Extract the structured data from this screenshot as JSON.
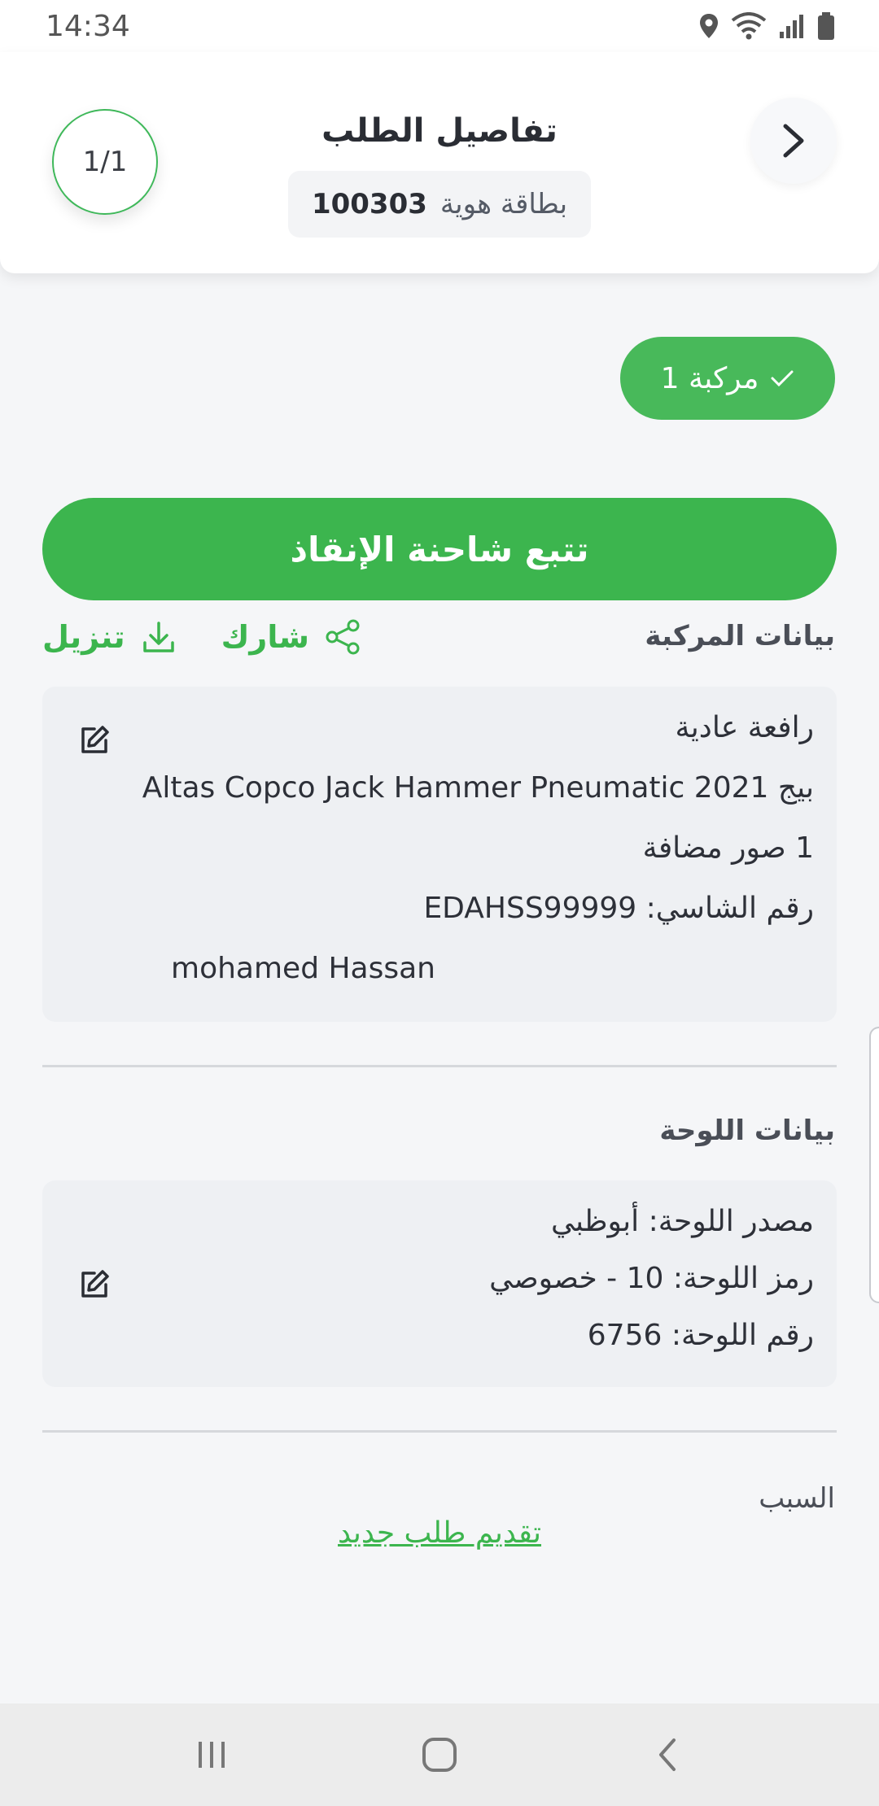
{
  "status_bar": {
    "time": "14:34",
    "icons": [
      "location-icon",
      "wifi-icon",
      "signal-icon",
      "battery-icon"
    ]
  },
  "header": {
    "title": "تفاصيل الطلب",
    "counter": "1/1",
    "id_label": "بطاقة هوية",
    "id_number": "100303"
  },
  "vehicle_chip": {
    "label": "مركبة 1"
  },
  "track_button": {
    "label": "تتبع شاحنة الإنقاذ"
  },
  "vehicle_section": {
    "title": "بيانات المركبة",
    "share_label": "شارك",
    "download_label": "تنزيل",
    "lines": [
      "رافعة عادية",
      "بيج 2021 Altas Copco Jack Hammer Pneumatic",
      "1 صور مضافة",
      "رقم الشاسي: EDAHSS99999",
      "mohamed Hassan"
    ]
  },
  "plate_section": {
    "title": "بيانات اللوحة",
    "lines": [
      "مصدر اللوحة: أبوظبي",
      "رمز اللوحة: 10 - خصوصي",
      "رقم اللوحة: 6756"
    ]
  },
  "reason": {
    "title": "السبب"
  },
  "new_request": {
    "label": "تقديم طلب جديد"
  },
  "colors": {
    "accent": "#3cb54e",
    "chip": "#48b95a",
    "card": "#eef0f3"
  }
}
